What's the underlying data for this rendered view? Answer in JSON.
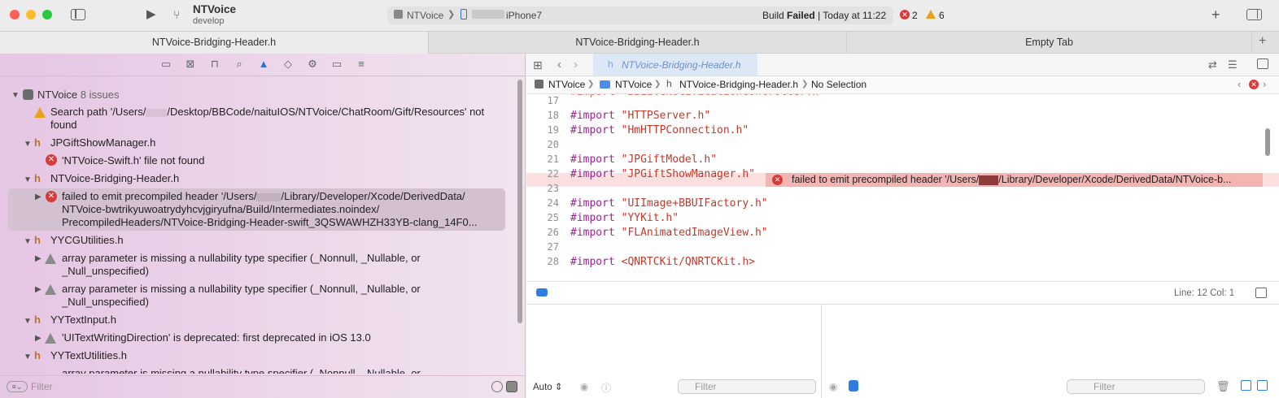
{
  "toolbar": {
    "project_name": "NTVoice",
    "branch": "develop",
    "scheme": "NTVoice",
    "device": "iPhone7",
    "build_status_prefix": "Build",
    "build_status_bold": "Failed",
    "build_status_time": "| Today at 11:22",
    "error_count": "2",
    "warning_count": "6",
    "colors": {
      "close": "#ff5f57",
      "minimize": "#febc2e",
      "zoom": "#28c840",
      "error": "#d63c3c",
      "warning": "#e8a21a"
    }
  },
  "tabs": [
    {
      "label": "NTVoice-Bridging-Header.h",
      "active": true
    },
    {
      "label": "NTVoice-Bridging-Header.h",
      "active": false
    },
    {
      "label": "Empty Tab",
      "active": false
    }
  ],
  "navigator": {
    "icons": [
      "folder-icon",
      "source-control-icon",
      "bookmark-icon",
      "find-icon",
      "issue-icon",
      "test-icon",
      "debug-icon",
      "breakpoint-icon",
      "report-icon"
    ],
    "root": {
      "title": "NTVoice",
      "count": "8 issues"
    },
    "search_path_warning_1": "Search path '/Users/",
    "search_path_warning_2": "/Desktop/BBCode/naituIOS/NTVoice/ChatRoom/Gift/Resources' not",
    "search_path_warning_3": "found",
    "groups": [
      {
        "file": "JPGiftShowManager.h",
        "issues": [
          "'NTVoice-Swift.h' file not found"
        ]
      },
      {
        "file": "NTVoice-Bridging-Header.h",
        "issues": [
          "failed to emit precompiled header '/Users/",
          "/Library/Developer/Xcode/DerivedData/",
          "NTVoice-bwtrikyuwoatrydyhcvjgiryufna/Build/Intermediates.noindex/",
          "PrecompiledHeaders/NTVoice-Bridging-Header-swift_3QSWAWHZH33YB-clang_14F0..."
        ]
      },
      {
        "file": "YYCGUtilities.h",
        "issues": [
          "array parameter is missing a nullability type specifier (_Nonnull, _Nullable, or",
          "_Null_unspecified)",
          "array parameter is missing a nullability type specifier (_Nonnull, _Nullable, or",
          "_Null_unspecified)"
        ]
      },
      {
        "file": "YYTextInput.h",
        "issues": [
          "'UITextWritingDirection' is deprecated: first deprecated in iOS 13.0"
        ]
      },
      {
        "file": "YYTextUtilities.h",
        "issues": [
          "array parameter is missing a nullability type specifier (_Nonnull, _Nullable, or"
        ]
      }
    ],
    "filter_placeholder": "Filter"
  },
  "editor": {
    "tab_file": "NTVoice-Bridging-Header.h",
    "jump_bar": [
      "NTVoice",
      "NTVoice",
      "NTVoice-Bridging-Header.h",
      "No Selection"
    ],
    "lines": [
      {
        "n": "17",
        "code": ""
      },
      {
        "n": "18",
        "code": "#import \"HTTPServer.h\""
      },
      {
        "n": "19",
        "code": "#import \"HmHTTPConnection.h\""
      },
      {
        "n": "20",
        "code": ""
      },
      {
        "n": "21",
        "code": "#import \"JPGiftModel.h\""
      },
      {
        "n": "22",
        "code": "#import \"JPGiftShowManager.h\""
      },
      {
        "n": "23",
        "code": ""
      },
      {
        "n": "24",
        "code": "#import \"UIImage+BBUIFactory.h\""
      },
      {
        "n": "25",
        "code": "#import \"YYKit.h\""
      },
      {
        "n": "26",
        "code": "#import \"FLAnimatedImageView.h\""
      },
      {
        "n": "27",
        "code": ""
      },
      {
        "n": "28",
        "code": "#import <QNRTCKit/QNRTCKit.h>"
      }
    ],
    "error_banner": "failed to emit precompiled header '/Users/",
    "error_banner_2": "/Library/Developer/Xcode/DerivedData/NTVoice-b...",
    "cursor": "Line: 12  Col: 1",
    "debug_mode": "Auto",
    "filter_placeholder": "Filter",
    "filter2_placeholder": "Filter"
  }
}
